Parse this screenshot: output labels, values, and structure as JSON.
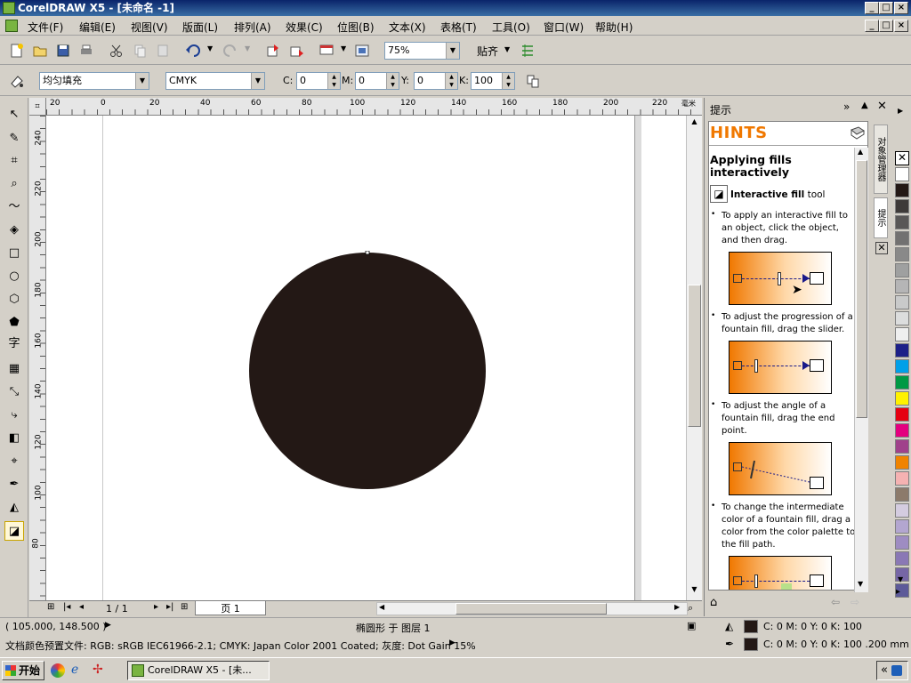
{
  "window": {
    "title": "CorelDRAW X5 - [未命名 -1]"
  },
  "menus": [
    "文件(F)",
    "编辑(E)",
    "视图(V)",
    "版面(L)",
    "排列(A)",
    "效果(C)",
    "位图(B)",
    "文本(X)",
    "表格(T)",
    "工具(O)",
    "窗口(W)",
    "帮助(H)"
  ],
  "toolbar": {
    "zoom": "75%",
    "snap_label": "贴齐"
  },
  "property_bar": {
    "fill_type": "均匀填充",
    "color_model": "CMYK",
    "c_label": "C:",
    "c": "0",
    "m_label": "M:",
    "m": "0",
    "y_label": "Y:",
    "y": "0",
    "k_label": "K:",
    "k": "100"
  },
  "ruler_h": [
    "20",
    "0",
    "20",
    "40",
    "60",
    "80",
    "100",
    "120",
    "140",
    "160",
    "180",
    "200",
    "220"
  ],
  "ruler_h_unit": "毫米",
  "ruler_v": [
    "240",
    "220",
    "200",
    "180",
    "160",
    "140",
    "120",
    "100",
    "80"
  ],
  "page_nav": {
    "counter": "1 / 1",
    "tab": "页 1"
  },
  "hints": {
    "panel_title": "提示",
    "header": "HINTS",
    "heading": "Applying fills interactively",
    "tool_name": "Interactive fill",
    "tool_suffix": " tool",
    "items": [
      "To apply an interactive fill to an object, click the object, and then drag.",
      "To adjust the progression of a fountain fill, drag the slider.",
      "To adjust the angle of a fountain fill, drag the end point.",
      "To change the intermediate color of a fountain fill, drag a color from the color palette to the fill path."
    ],
    "side_tabs": [
      "对象管理器",
      "提示"
    ]
  },
  "status": {
    "coords": "( 105.000, 148.500 )",
    "object_info": "椭圆形 于 图层 1",
    "profile": "文档颜色预置文件: RGB: sRGB IEC61966-2.1; CMYK: Japan Color 2001 Coated; 灰度: Dot Gain 15%",
    "fill_info": "C: 0 M: 0 Y: 0 K: 100",
    "outline_info": "C: 0 M: 0 Y: 0 K: 100  .200 mm"
  },
  "taskbar": {
    "start": "开始",
    "task": "CorelDRAW X5 - [未..."
  },
  "colors": {
    "circle": "#231815",
    "accent": "#f07800"
  },
  "palette": [
    "#ffffff",
    "#231815",
    "#3e3a39",
    "#595757",
    "#727171",
    "#898989",
    "#9fa0a0",
    "#b5b5b6",
    "#c9caca",
    "#dcdddd",
    "#efefef",
    "#1d2088",
    "#00a0e9",
    "#009944",
    "#fff100",
    "#e60012",
    "#e4007f",
    "#a0418b",
    "#f08300",
    "#f5b2b2",
    "#8c7a6b",
    "#d4cce0",
    "#b3a6d0",
    "#9e8cc2",
    "#8a78b5",
    "#7666a6",
    "#5d5a99"
  ]
}
